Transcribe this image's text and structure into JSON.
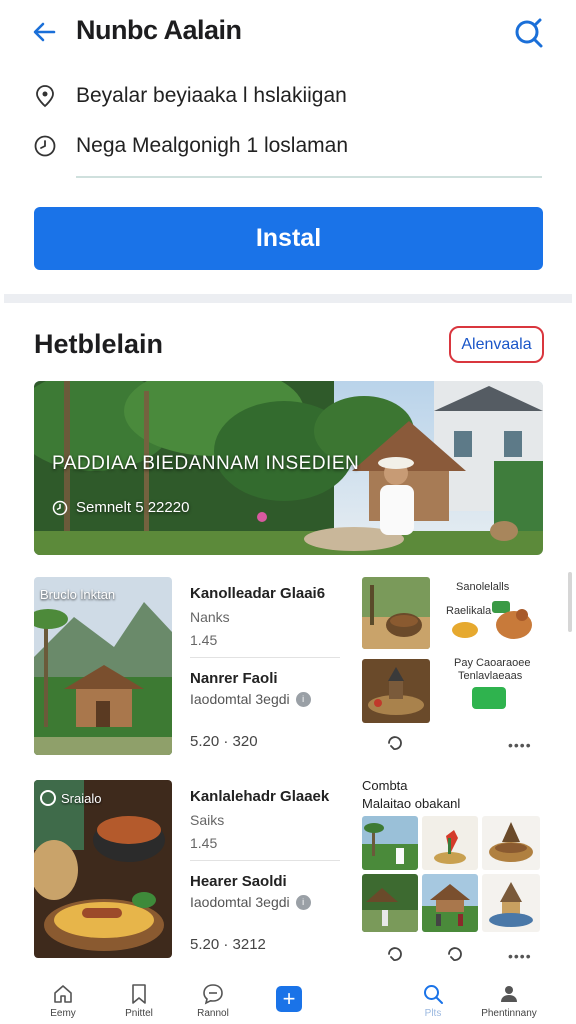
{
  "header": {
    "title": "Nunbc Aalain",
    "back_icon": "arrow-left-icon",
    "search_icon": "search-icon"
  },
  "info": {
    "location": "Beyalar beyiaaka l hslakiigan",
    "hours": "Nega Mealgonigh 1 loslaman"
  },
  "install_button": "Instal",
  "section": {
    "title": "Hetblelain",
    "action": "Alenvaala"
  },
  "hero": {
    "title": "PADDIAA BIEDANNAM INSEDIEN",
    "subtitle": "Semnelt 5 22220"
  },
  "cards": [
    {
      "thumb_label": "Bruclo lnktan",
      "line1": "Kanolleadar Glaai6",
      "line2": "Nanks",
      "line3": "1.45",
      "line4": "Nanrer Faoli",
      "line5": "Iaodomtal 3egdi",
      "line6": "5.20 · 320"
    },
    {
      "thumb_label": "Sraialo",
      "line1": "Kanlalehadr Glaaek",
      "line2": "Saiks",
      "line3": "1.45",
      "line4": "Hearer Saoldi",
      "line5": "Iaodomtal 3egdi",
      "line6": "5.20 · 3212"
    }
  ],
  "side1": {
    "caption_top": "Sanolelalls",
    "caption_mid": "Raelikala",
    "caption_bot1": "Pay Caoaraoee",
    "caption_bot2": "Tenlavlaeaas",
    "more": "••••"
  },
  "side2": {
    "title1": "Combta",
    "title2": "Malaitao obakanl",
    "more": "••••"
  },
  "nav": [
    {
      "label": "Eemy",
      "icon": "home-icon"
    },
    {
      "label": "Pnittel",
      "icon": "bookmark-icon"
    },
    {
      "label": "Rannol",
      "icon": "chat-icon"
    },
    {
      "label": "",
      "icon": "add-icon"
    },
    {
      "label": "Plts",
      "icon": "search-icon"
    },
    {
      "label": "Phentinnany",
      "icon": "profile-icon"
    }
  ],
  "colors": {
    "accent": "#1a73e8",
    "pill_border": "#d9363e",
    "green": "#2fb34e"
  }
}
